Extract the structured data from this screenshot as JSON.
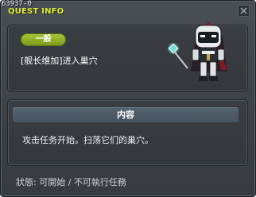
{
  "window": {
    "quest_id": "63937-0",
    "title": "QUEST INFO"
  },
  "quest": {
    "category": "一般",
    "name": "[舰长维加]进入巢穴",
    "npc_icon": "npc-portrait"
  },
  "content": {
    "header": "内容",
    "description": "攻击任务开始。扫荡它们的巢穴。"
  },
  "status": {
    "text": "狀態: 可開始 / 不可執行任務"
  },
  "colors": {
    "title": "#d8ea3a",
    "badge": "#8fb02a",
    "header_bar": "#4f5d6a"
  }
}
